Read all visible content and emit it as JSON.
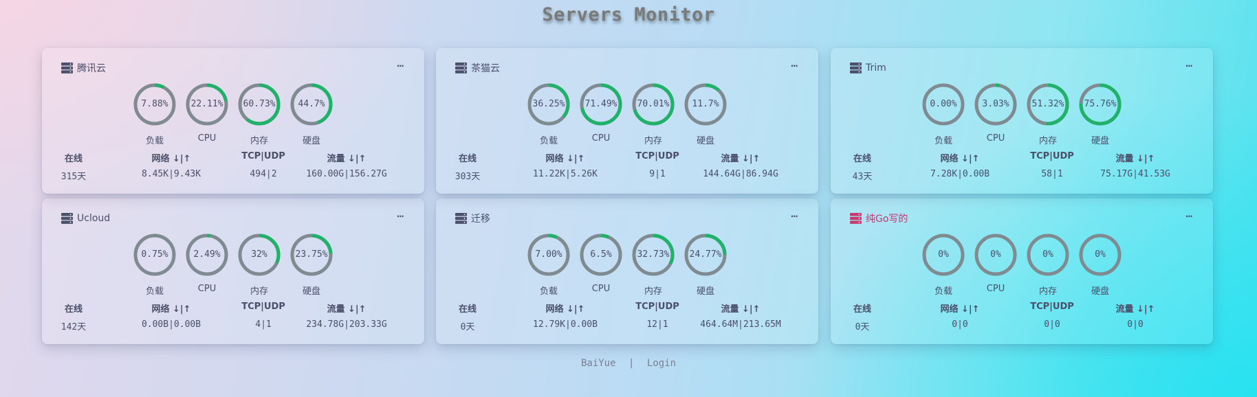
{
  "page": {
    "title": "Servers Monitor"
  },
  "colors": {
    "ring_track": "#7f8b90",
    "ring_fill": "#21b26a",
    "text": "#4a4f6a",
    "highlight_name": "#c23a6e"
  },
  "labels": {
    "gauges": [
      "负载",
      "CPU",
      "内存",
      "硬盘"
    ],
    "online": "在线",
    "network": "网络 ↓|↑",
    "tcpudp": "TCP|UDP",
    "traffic": "流量 ↓|↑"
  },
  "more_icon": "⋯",
  "servers": [
    {
      "name": "腾讯云",
      "highlight": false,
      "gauges": [
        {
          "text": "7.88%",
          "pct": 7.88
        },
        {
          "text": "22.11%",
          "pct": 22.11
        },
        {
          "text": "60.73%",
          "pct": 60.73
        },
        {
          "text": "44.7%",
          "pct": 44.7
        }
      ],
      "online": "315天",
      "network": "8.45K|9.43K",
      "tcpudp": "494|2",
      "traffic": "160.00G|156.27G"
    },
    {
      "name": "茶猫云",
      "highlight": false,
      "gauges": [
        {
          "text": "36.25%",
          "pct": 36.25
        },
        {
          "text": "71.49%",
          "pct": 71.49
        },
        {
          "text": "70.01%",
          "pct": 70.01
        },
        {
          "text": "11.7%",
          "pct": 11.7
        }
      ],
      "online": "303天",
      "network": "11.22K|5.26K",
      "tcpudp": "9|1",
      "traffic": "144.64G|86.94G"
    },
    {
      "name": "Trim",
      "highlight": false,
      "gauges": [
        {
          "text": "0.00%",
          "pct": 0.0
        },
        {
          "text": "3.03%",
          "pct": 3.03
        },
        {
          "text": "51.32%",
          "pct": 51.32
        },
        {
          "text": "75.76%",
          "pct": 75.76
        }
      ],
      "online": "43天",
      "network": "7.28K|0.00B",
      "tcpudp": "58|1",
      "traffic": "75.17G|41.53G"
    },
    {
      "name": "Ucloud",
      "highlight": false,
      "gauges": [
        {
          "text": "0.75%",
          "pct": 0.75
        },
        {
          "text": "2.49%",
          "pct": 2.49
        },
        {
          "text": "32%",
          "pct": 32
        },
        {
          "text": "23.75%",
          "pct": 23.75
        }
      ],
      "online": "142天",
      "network": "0.00B|0.00B",
      "tcpudp": "4|1",
      "traffic": "234.78G|203.33G"
    },
    {
      "name": "迁移",
      "highlight": false,
      "gauges": [
        {
          "text": "7.00%",
          "pct": 7.0
        },
        {
          "text": "6.5%",
          "pct": 6.5
        },
        {
          "text": "32.73%",
          "pct": 32.73
        },
        {
          "text": "24.77%",
          "pct": 24.77
        }
      ],
      "online": "0天",
      "network": "12.79K|0.00B",
      "tcpudp": "12|1",
      "traffic": "464.64M|213.65M"
    },
    {
      "name": "纯Go写的",
      "highlight": true,
      "gauges": [
        {
          "text": "0%",
          "pct": 0
        },
        {
          "text": "0%",
          "pct": 0
        },
        {
          "text": "0%",
          "pct": 0
        },
        {
          "text": "0%",
          "pct": 0
        }
      ],
      "online": "0天",
      "network": "0|0",
      "tcpudp": "0|0",
      "traffic": "0|0"
    }
  ],
  "footer": {
    "author": "BaiYue",
    "separator": "|",
    "login": "Login"
  }
}
